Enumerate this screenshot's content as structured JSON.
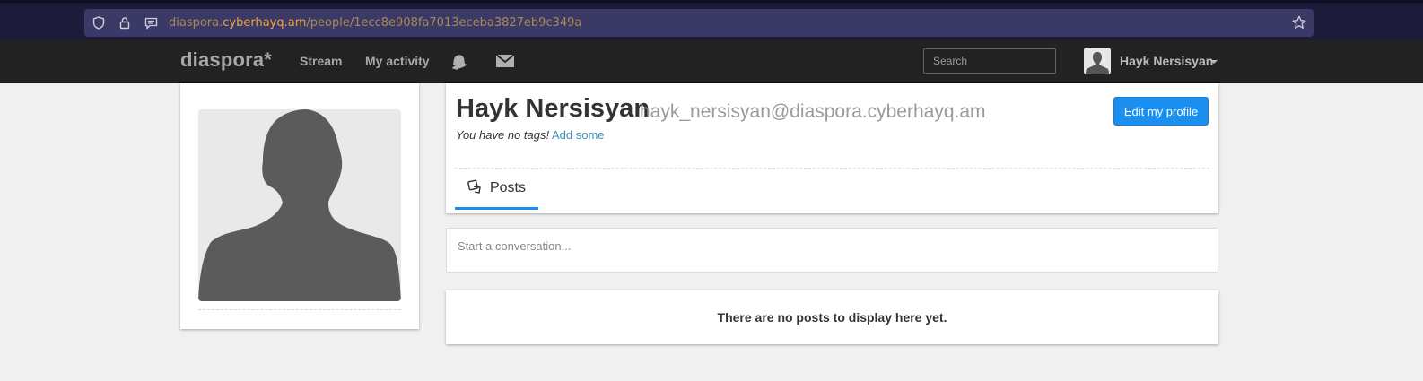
{
  "browser": {
    "url_prefix": "diaspora.",
    "url_host": "cyberhayq.am",
    "url_path": "/people/1ecc8e908fa7013eceba3827eb9c349a"
  },
  "header": {
    "brand": "diaspora*",
    "nav": [
      {
        "label": "Stream"
      },
      {
        "label": "My activity"
      }
    ],
    "icons": [
      "bell-icon",
      "envelope-icon"
    ],
    "search_placeholder": "Search",
    "user_name": "Hayk Nersisyan"
  },
  "profile": {
    "name": "Hayk Nersisyan",
    "handle": "hayk_nersisyan@diaspora.cyberhayq.am",
    "no_tags_text": "You have no tags!",
    "add_tags_link": "Add some",
    "edit_button": "Edit my profile",
    "tabs": [
      {
        "label": "Posts",
        "icon": "posts-icon",
        "active": true
      }
    ]
  },
  "publisher": {
    "placeholder": "Start a conversation..."
  },
  "stream": {
    "empty_message": "There are no posts to display here yet."
  },
  "colors": {
    "accent": "#1a8ff0",
    "link": "#3f8fba",
    "header_bg": "#222222",
    "page_bg": "#f0f0f0"
  }
}
